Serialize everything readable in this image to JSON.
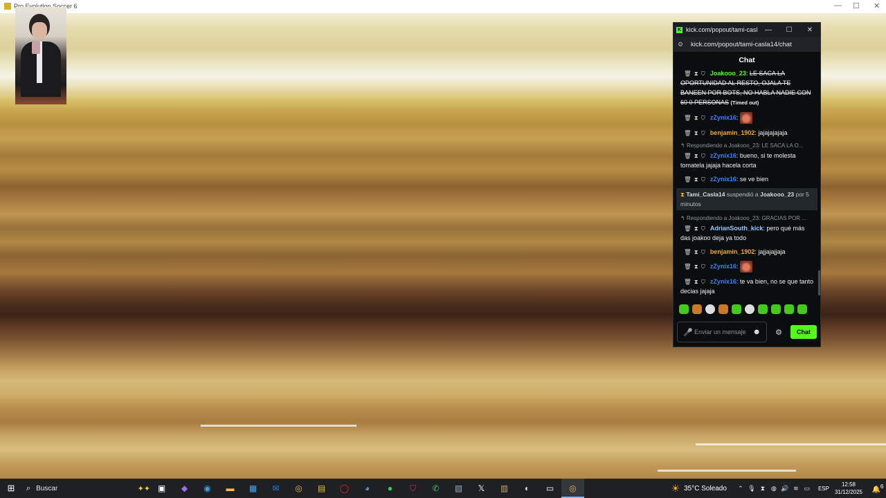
{
  "game_window": {
    "title": "Pro Evolution Soccer 6",
    "min_label": "—",
    "max_label": "☐",
    "close_label": "✕"
  },
  "chat_window": {
    "window_title": "kick.com/popout/tami-casla...",
    "url": "kick.com/popout/tami-casla14/chat",
    "header": "Chat",
    "minimize": "—",
    "maximize": "☐",
    "close": "✕",
    "input_placeholder": "Enviar un mensaje",
    "send_label": "Chat",
    "messages": [
      {
        "user": "Joakooo_23",
        "color": "#53fc18",
        "text": "LE SACA LA OPORTUNIDAD AL RESTO, OJALA TE BANEEN POR BOTS, NO HABLA NADIE CON 60 0 PERSONAS",
        "suffix": "(Timed out)"
      },
      {
        "user": "zZynix16",
        "color": "#3b82f6",
        "emote": true
      },
      {
        "user": "benjamin_1902",
        "color": "#f5a623",
        "text": "jajajajajaja"
      },
      {
        "reply": "Respondiendo a Joakooo_23: LE SACA LA O...",
        "user": "zZynix16",
        "color": "#3b82f6",
        "text": "bueno, si te molesta tomatela jajaja hacela corta"
      },
      {
        "user": "zZynix16",
        "color": "#3b82f6",
        "text": "se ve bien"
      },
      {
        "system": true,
        "actor": "Tami_Casla14",
        "verb": "suspendió a",
        "target": "Joakooo_23",
        "tail": "por 5 minutos"
      },
      {
        "reply": "Respondiendo a Joakooo_23: GRACIAS POR ...",
        "user": "AdrianSouth_kick",
        "color": "#8ecbff",
        "text": "pero qué más das joakoo deja ya todo"
      },
      {
        "user": "benjamin_1902",
        "color": "#f5a623",
        "text": "jajjajajjaja"
      },
      {
        "user": "zZynix16",
        "color": "#3b82f6",
        "emote": true
      },
      {
        "user": "zZynix16",
        "color": "#3b82f6",
        "text": "te va bien, no se que tanto decias jajaja"
      }
    ]
  },
  "taskbar": {
    "search_label": "Buscar",
    "weather": "35°C  Soleado",
    "language": "ESP",
    "time": "12:58",
    "date": "31/12/2025",
    "notification_count": "6"
  }
}
